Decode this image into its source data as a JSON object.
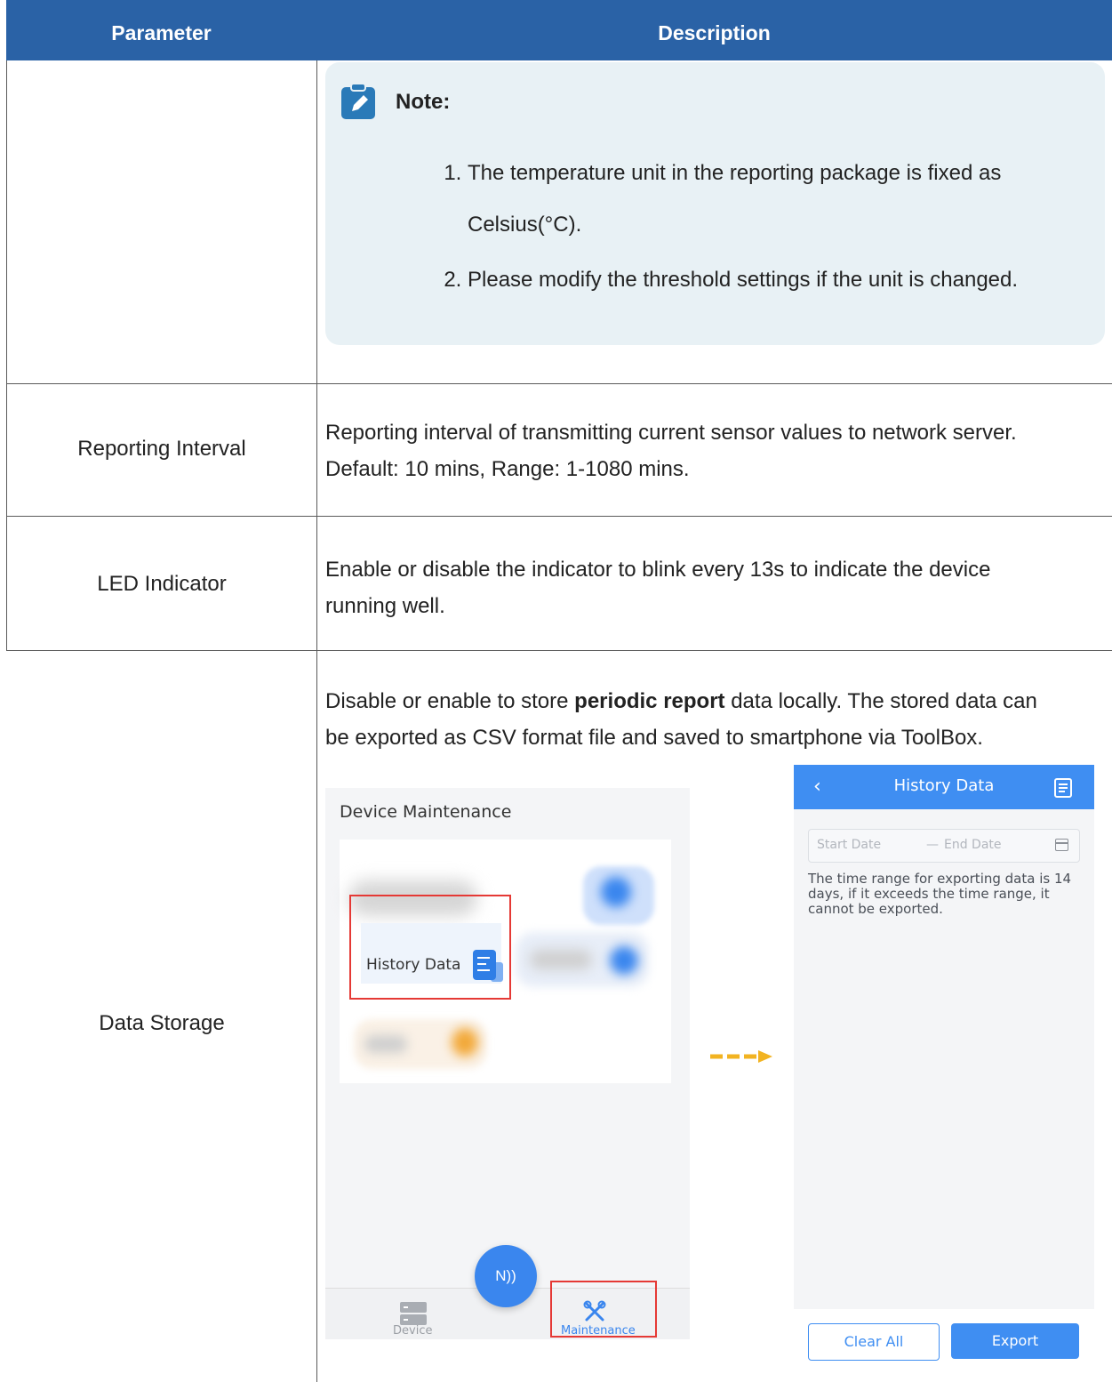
{
  "table": {
    "headers": {
      "parameter": "Parameter",
      "description": "Description"
    }
  },
  "note": {
    "title": "Note:",
    "items": [
      "The temperature unit in the reporting package is fixed as Celsius(°C).",
      "Please modify the threshold settings if the unit is changed."
    ]
  },
  "rows": {
    "reporting_interval": {
      "parameter": "Reporting Interval",
      "line1": "Reporting interval of transmitting current sensor values to network server.",
      "line2": "Default: 10 mins, Range: 1-1080 mins."
    },
    "led_indicator": {
      "parameter": "LED Indicator",
      "line1": "Enable or disable the indicator to blink every 13s to indicate the device",
      "line2": "running well."
    },
    "data_storage": {
      "parameter": "Data Storage",
      "text_before": "Disable or enable to store ",
      "text_bold": "periodic report",
      "text_after": " data locally. The stored data can",
      "line2": "be exported as CSV format file and saved to smartphone via ToolBox."
    }
  },
  "device_maintenance_screen": {
    "title": "Device Maintenance",
    "history_tile_label": "History Data",
    "tabs": {
      "device": "Device",
      "maintenance": "Maintenance"
    },
    "nfc_label": "N))"
  },
  "history_data_screen": {
    "title": "History Data",
    "start_placeholder": "Start Date",
    "separator": "—",
    "end_placeholder": "End Date",
    "hint": "The time range for exporting data is 14 days, if it exceeds the time range, it cannot be exported.",
    "clear_button": "Clear All",
    "export_button": "Export"
  },
  "colors": {
    "header_bg": "#2a62a6",
    "note_bg": "#e8f1f5",
    "app_blue": "#3f8ef2",
    "highlight_red": "#e53935",
    "arrow_orange": "#f2b321"
  },
  "icons": [
    "note-pencil-icon",
    "history-doc-icon",
    "nfc-icon",
    "device-tab-icon",
    "maintenance-tools-icon",
    "back-chevron-icon",
    "export-doc-icon",
    "calendar-icon",
    "dashed-arrow-icon"
  ]
}
